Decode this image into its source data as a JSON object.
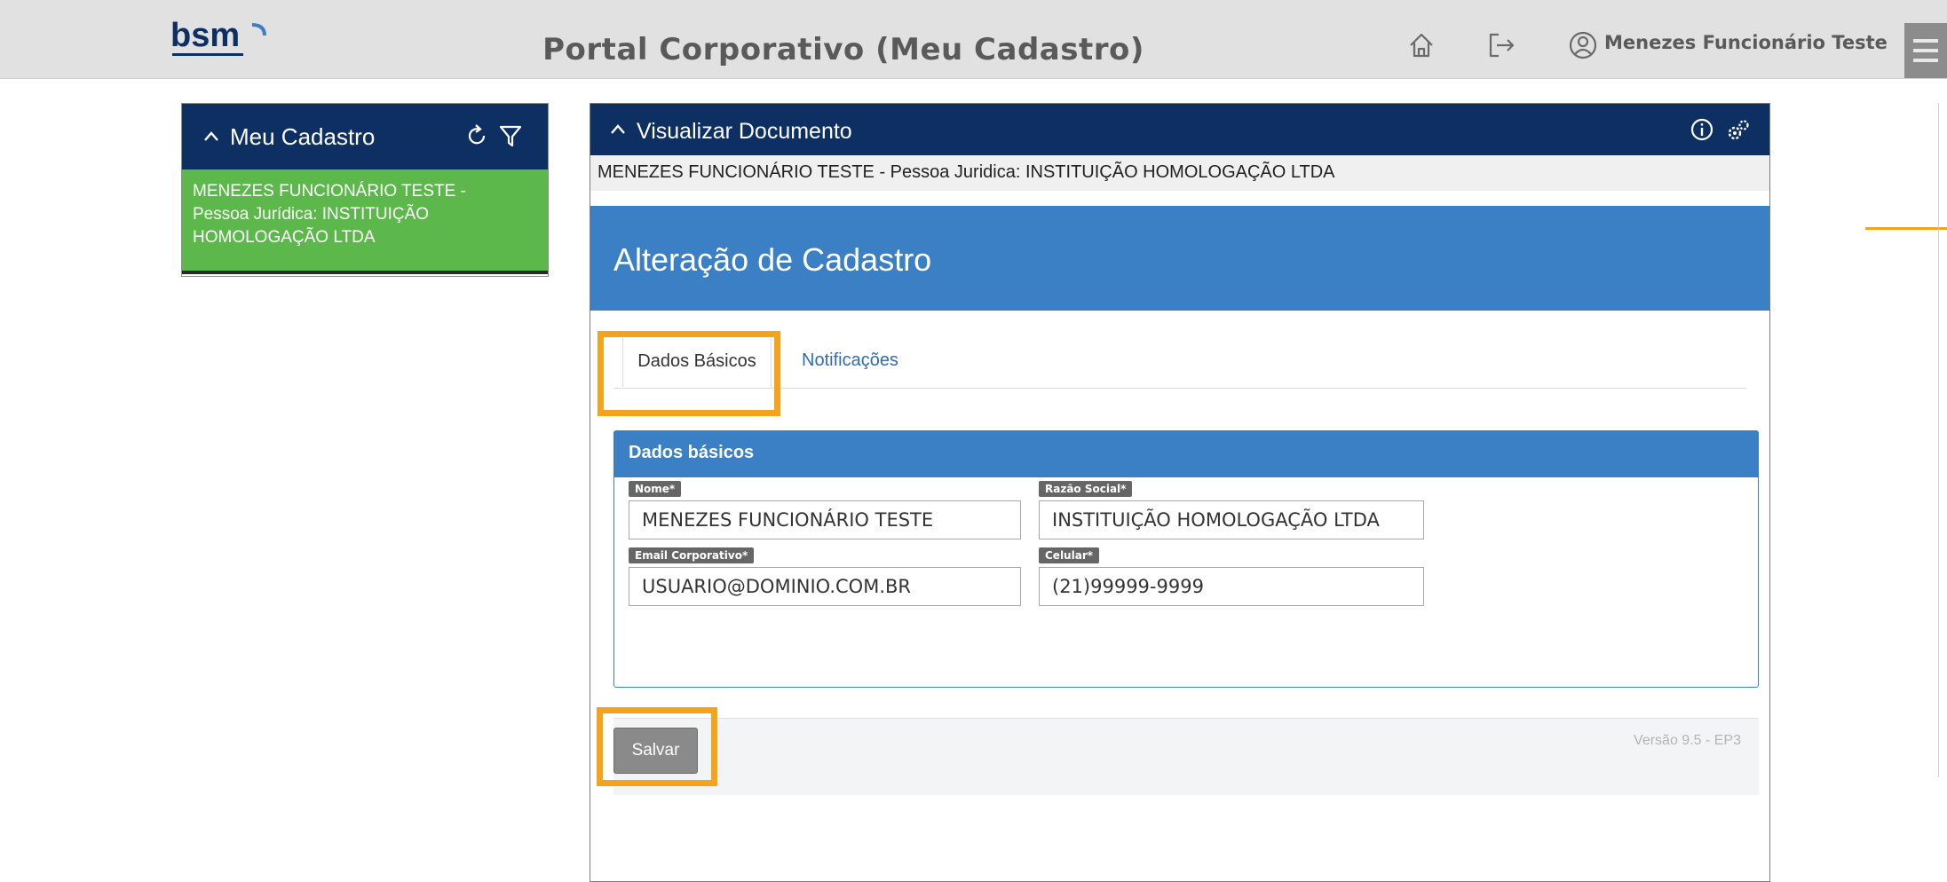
{
  "topbar": {
    "logo_text": "bsm",
    "title": "Portal Corporativo (Meu Cadastro)",
    "user_name": "Menezes Funcionário Teste",
    "icons": [
      "home-icon",
      "logout-icon",
      "user-icon",
      "hamburger-menu-icon"
    ]
  },
  "left_panel": {
    "title": "Meu Cadastro",
    "item_line1": "MENEZES FUNCIONÁRIO TESTE -",
    "item_line2": "Pessoa Jurídica: INSTITUIÇÃO",
    "item_line3": "HOMOLOGAÇÃO LTDA",
    "item_color": "#5cb84a",
    "icons": [
      "refresh-icon",
      "filter-icon"
    ]
  },
  "main_panel": {
    "title": "Visualizar Documento",
    "doc_line": "MENEZES FUNCIONÁRIO TESTE - Pessoa Juridica: INSTITUIÇÃO HOMOLOGAÇÃO LTDA",
    "icons": [
      "info-icon",
      "settings-icon"
    ],
    "banner_title": "Alteração de Cadastro",
    "tabs": [
      {
        "label": "Dados Básicos",
        "active": true
      },
      {
        "label": "Notificações",
        "active": false
      }
    ],
    "section_title": "Dados básicos",
    "fields": {
      "nome": {
        "label": "Nome*",
        "value": "MENEZES FUNCIONÁRIO TESTE"
      },
      "razao_social": {
        "label": "Razão Social*",
        "value": "INSTITUIÇÃO HOMOLOGAÇÃO LTDA"
      },
      "email": {
        "label": "Email Corporativo*",
        "value": "USUARIO@DOMINIO.COM.BR"
      },
      "celular": {
        "label": "Celular*",
        "value": "(21)99999-9999"
      }
    },
    "save_label": "Salvar",
    "version": "Versão 9.5 - EP3"
  },
  "colors": {
    "header_navy": "#0d2f62",
    "banner_blue": "#3b7fc4",
    "highlight_orange": "#f5a31a"
  }
}
